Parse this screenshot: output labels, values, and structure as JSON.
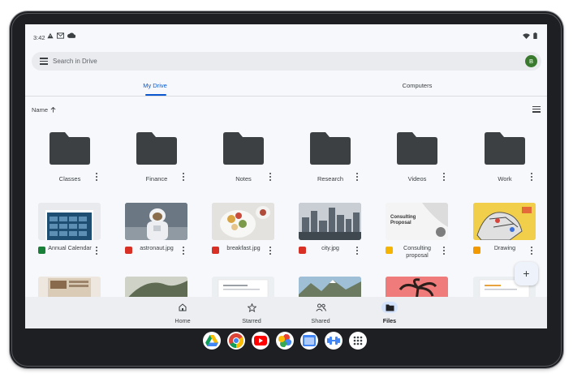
{
  "status_bar": {
    "time": "3:42"
  },
  "search": {
    "placeholder": "Search in Drive",
    "avatar_letter": "B"
  },
  "tabs": [
    {
      "label": "My Drive",
      "active": true
    },
    {
      "label": "Computers",
      "active": false
    }
  ],
  "sort": {
    "label": "Name",
    "direction": "ascending"
  },
  "folders": [
    {
      "name": "Classes"
    },
    {
      "name": "Finance"
    },
    {
      "name": "Notes"
    },
    {
      "name": "Research"
    },
    {
      "name": "Videos"
    },
    {
      "name": "Work"
    }
  ],
  "files": [
    {
      "name": "Annual Calendar",
      "type": "sheets-icon",
      "thumb_text": ""
    },
    {
      "name": "astronaut.jpg",
      "type": "image-icon",
      "thumb_text": ""
    },
    {
      "name": "breakfast.jpg",
      "type": "image-icon",
      "thumb_text": ""
    },
    {
      "name": "city.jpg",
      "type": "image-icon",
      "thumb_text": ""
    },
    {
      "name": "Consulting proposal",
      "type": "slides-icon",
      "thumb_text": "Consulting Proposal"
    },
    {
      "name": "Drawing",
      "type": "drawing-icon",
      "thumb_text": ""
    }
  ],
  "fab": {
    "label": "+"
  },
  "bottom_nav": [
    {
      "label": "Home",
      "icon": "home-icon",
      "active": false
    },
    {
      "label": "Starred",
      "icon": "star-icon",
      "active": false
    },
    {
      "label": "Shared",
      "icon": "people-icon",
      "active": false
    },
    {
      "label": "Files",
      "icon": "folder-icon",
      "active": true
    }
  ],
  "dock": [
    {
      "icon": "drive-app-icon"
    },
    {
      "icon": "chrome-app-icon"
    },
    {
      "icon": "youtube-app-icon"
    },
    {
      "icon": "photos-app-icon"
    },
    {
      "icon": "files-app-icon"
    },
    {
      "icon": "fitness-app-icon"
    },
    {
      "icon": "launcher-icon"
    }
  ],
  "colors": {
    "accent": "#0b57d0",
    "folder": "#3c4043",
    "avatar": "#3a7a2f",
    "nav_active": "#d3e3fd"
  }
}
